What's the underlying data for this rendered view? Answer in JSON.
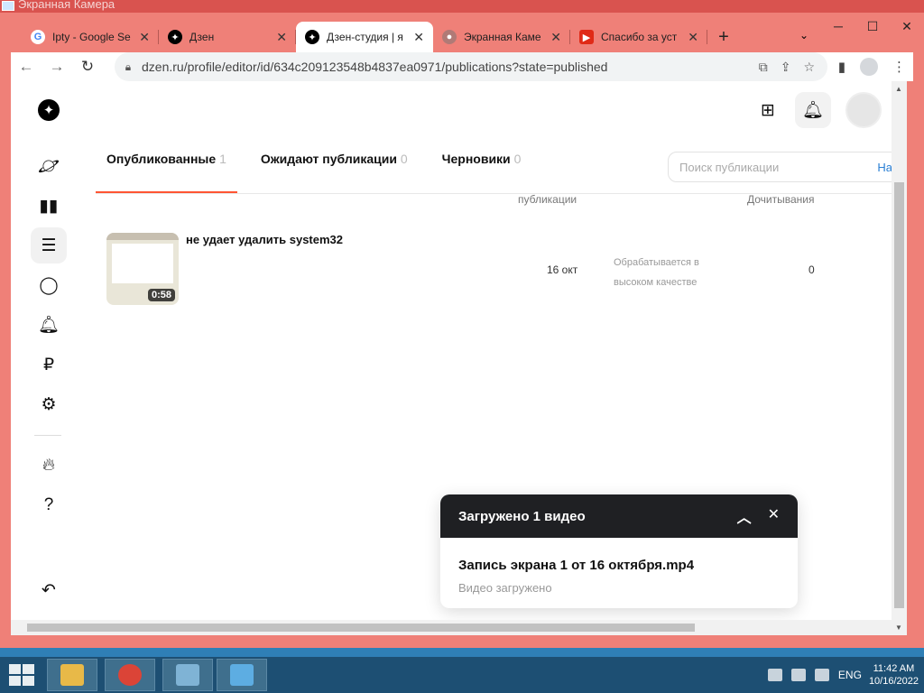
{
  "outer_window": {
    "title": "Экранная Камера"
  },
  "browser": {
    "tabs": [
      {
        "label": "Ipty - Google Se",
        "icon": "google-icon"
      },
      {
        "label": "Дзен",
        "icon": "dzen-icon"
      },
      {
        "label": "Дзен-студия | я",
        "icon": "dzen-icon",
        "active": true
      },
      {
        "label": "Экранная Каме",
        "icon": "site-icon"
      },
      {
        "label": "Спасибо за уст",
        "icon": "youtube-icon"
      }
    ],
    "url": "dzen.ru/profile/editor/id/634c209123548b4837ea0971/publications?state=published"
  },
  "publications": {
    "tabs": [
      {
        "label": "Опубликованные",
        "count": "1"
      },
      {
        "label": "Ожидают публикации",
        "count": "0"
      },
      {
        "label": "Черновики",
        "count": "0"
      }
    ],
    "search_placeholder": "Поиск публикации",
    "search_button": "На",
    "columns": {
      "date": "публикации",
      "reads": "Дочитывания"
    },
    "rows": [
      {
        "title": "не удает удалить system32",
        "duration": "0:58",
        "date": "16 окт",
        "status_line1": "Обрабатывается в",
        "status_line2": "высоком качестве",
        "reads": "0"
      }
    ]
  },
  "toast": {
    "title": "Загружено 1 видео",
    "file": "Запись экрана 1 от 16 октября.mp4",
    "status": "Видео загружено"
  },
  "taskbar": {
    "lang": "ENG",
    "time": "11:42 AM",
    "date": "10/16/2022"
  }
}
